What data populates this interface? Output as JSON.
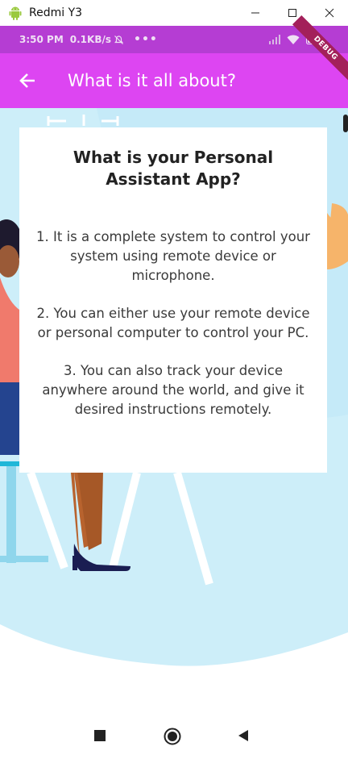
{
  "window": {
    "title": "Redmi Y3",
    "icon": "android-icon",
    "controls": [
      "minimize-icon",
      "maximize-icon",
      "close-icon"
    ]
  },
  "status_bar": {
    "time": "3:50 PM",
    "speed": "0.1KB/s",
    "more": "•••",
    "icons": [
      "mute-icon",
      "signal-icon",
      "wifi-icon",
      "battery-icon"
    ]
  },
  "debug_banner": "DEBUG",
  "app_bar": {
    "title": "What is it all about?",
    "back_icon": "arrow-back-icon"
  },
  "card": {
    "title": "What is your Personal Assistant App?",
    "points": [
      "1. It is a complete system to control your system using remote device or microphone.",
      "2. You can either use your remote device or personal computer to control your PC.",
      "3. You can also track your device anywhere around the world, and give it desired instructions remotely."
    ]
  },
  "nav_bar": {
    "icons": [
      "recents-icon",
      "home-icon",
      "back-triangle-icon"
    ]
  },
  "colors": {
    "status_bar": "#b53dd3",
    "app_bar": "#dd45f2",
    "ribbon": "#a3205a",
    "background_blue": "#cdeef9"
  }
}
